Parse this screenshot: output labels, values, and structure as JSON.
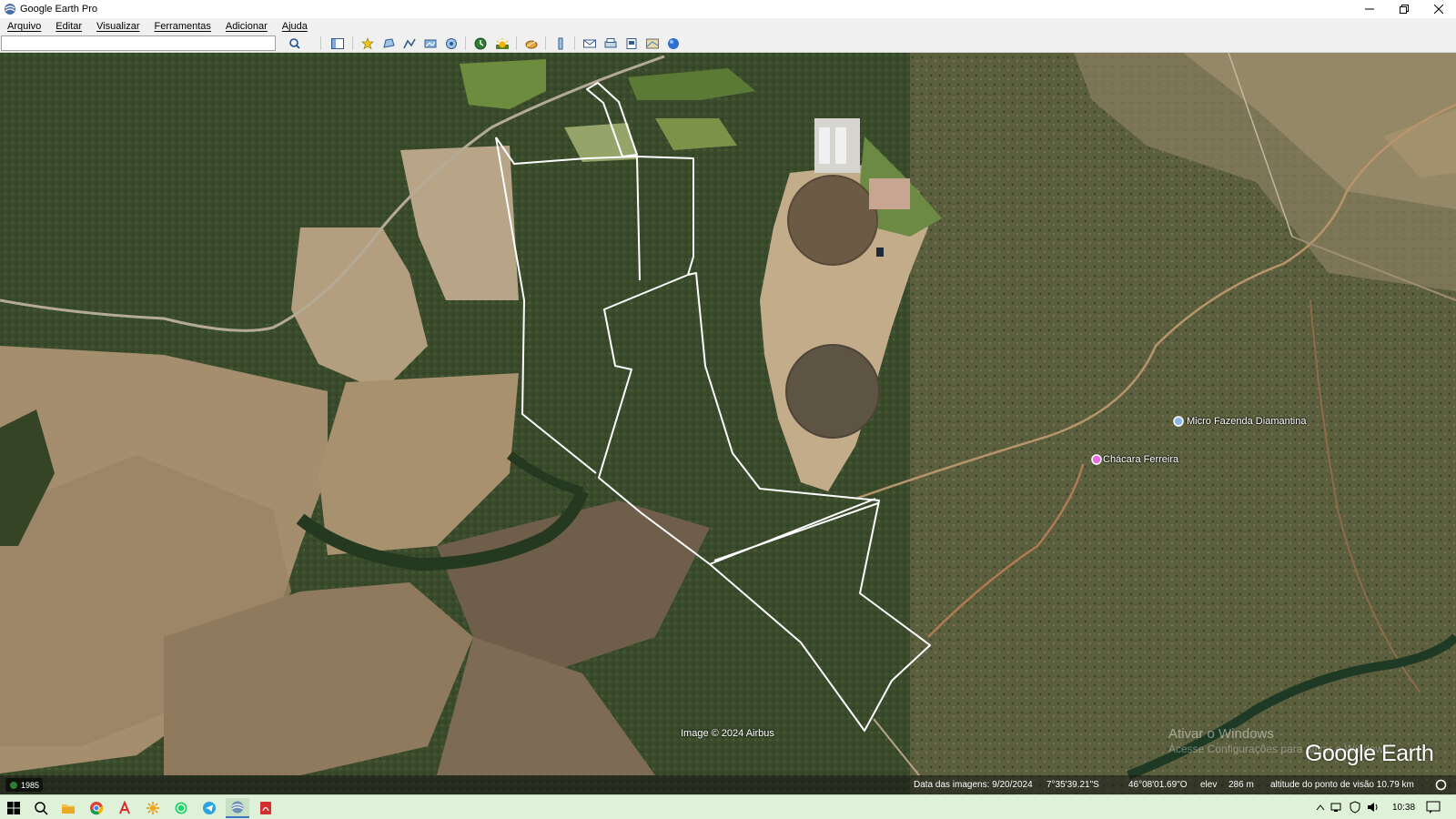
{
  "window": {
    "title": "Google Earth Pro",
    "controls": [
      "minimize",
      "restore",
      "close"
    ]
  },
  "menu": {
    "items": [
      "Arquivo",
      "Editar",
      "Visualizar",
      "Ferramentas",
      "Adicionar",
      "Ajuda"
    ]
  },
  "search": {
    "value": "",
    "placeholder": ""
  },
  "toolbar": {
    "icons": [
      "search-icon",
      "sidebar-toggle-icon",
      "placemark-icon",
      "polygon-icon",
      "path-icon",
      "overlay-icon",
      "tour-icon",
      "historical-imagery-icon",
      "sun-icon",
      "planets-icon",
      "ruler-icon",
      "email-icon",
      "print-icon",
      "save-image-icon",
      "google-maps-icon",
      "earth-icon"
    ]
  },
  "map": {
    "places": [
      {
        "name": "Micro Fazenda Diamantina",
        "icon": "blue-place-icon"
      },
      {
        "name": "Chácara Ferreira",
        "icon": "pink-place-icon"
      }
    ],
    "credit": "Image © 2024 Airbus",
    "watermark": [
      "Ativar o Windows",
      "Acesse Configurações para ativar o Windows."
    ],
    "logo": "Google Earth"
  },
  "status": {
    "year": "1985",
    "imagery_date": "Data das imagens: 9/20/2024",
    "latitude": "7°35'39.21\"S",
    "longitude": "46°08'01.69\"O",
    "elev_label": "elev",
    "elev_value": "286 m",
    "eye_alt": "altitude do ponto de visão  10.79 km"
  },
  "taskbar": {
    "apps": [
      "start-icon",
      "search-icon",
      "file-explorer-icon",
      "chrome-icon",
      "pdf-reader-icon",
      "settings-sun-icon",
      "whatsapp-icon",
      "telegram-icon",
      "google-earth-icon",
      "acrobat-icon"
    ],
    "time": "10:38"
  },
  "colors": {
    "boundary": "#ffffff",
    "taskbar": "#dff1d8"
  }
}
